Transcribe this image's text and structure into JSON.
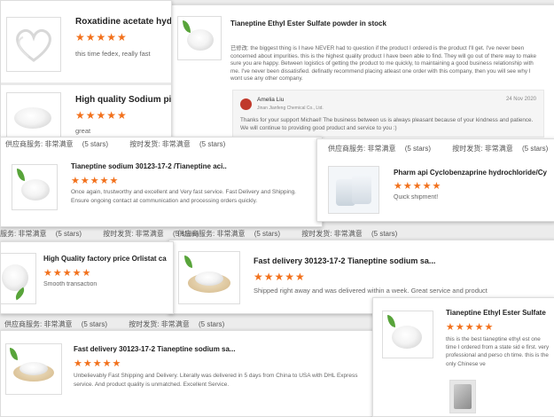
{
  "cards": {
    "roxatidine": {
      "title": "Roxatidine acetate hydro",
      "stars": "★★★★★",
      "text": "this time fedex, really fast"
    },
    "orlistat_sodium": {
      "title": "High quality Sodium pic",
      "stars": "★★★★★",
      "text": "great"
    },
    "tianeptine_ester_top": {
      "title": "Tianeptine Ethyl Ester Sulfate powder in stock",
      "text": "已修改: the biggest thing is I have NEVER had to question if the product I ordered is the product I'll get. I've never been concerned about impurities. this is the highest quality product I have been able to find. They will go out of there way to make sure you are happy. Between logistics of getting the product to me quickly, to maintaining a good business relationship with me. I've never been dissatisfied. definatly recommend placing atleast one order with this company, then you will see why I wont use any other company.",
      "reply": {
        "name": "Amelia Liu",
        "company": "Jinan Jianfeng Chemical Co., Ltd.",
        "date": "24 Nov 2020",
        "text": "Thanks for your support Michael! The business between us is always pleasant because of your kindness and patience. We will continue to providing good product and service to you :)"
      }
    },
    "tianeptine_sodium_1": {
      "title": "Tianeptine sodium 30123-17-2 /Tianeptine aci..",
      "stars": "★★★★★",
      "text": "Once again, trustworthy and excellent and Very fast service. Fast Delivery and Shipping. Ensure ongoing contact at communication and processing orders quickly."
    },
    "cyclobenzaprine": {
      "title": "Pharm api Cyclobenzaprine hydrochloride/Cy",
      "stars": "★★★★★",
      "text": "Quick shipment!"
    },
    "orlistat": {
      "title": "High Quality factory price Orlistat ca",
      "stars": "★★★★★",
      "text": "Smooth transaction"
    },
    "tianeptine_sodium_2": {
      "title": "Fast delivery 30123-17-2 Tianeptine sodium sa...",
      "stars": "★★★★★",
      "text": "Shipped right away and was delivered within a week. Great service and product"
    },
    "tianeptine_sodium_3": {
      "title": "Fast delivery 30123-17-2 Tianeptine sodium sa...",
      "stars": "★★★★★",
      "text": "Unbelievably Fast Shipping and Delivery. Literally was delivered in 5 days from China to USA with DHL Express service. And product quality is unmatched. Excellent Service."
    },
    "tianeptine_ester_bottom": {
      "title": "Tianeptine Ethyl Ester Sulfate",
      "stars": "★★★★★",
      "text": "this is the best tianeptine ethyl est one time I ordered from a state sid e first. very professional and perso ch time. this is the only Chinese ve"
    }
  },
  "meta": {
    "supplier_label": "供应商服务:",
    "supplier_value": "非常满意",
    "five_stars": "(5 stars)",
    "ontime_label": "按时发货:",
    "ontime_value": "非常满意",
    "supplier_label_short": "服务:"
  },
  "colors": {
    "star": "#f2711c",
    "avatar": "#c0392b"
  }
}
